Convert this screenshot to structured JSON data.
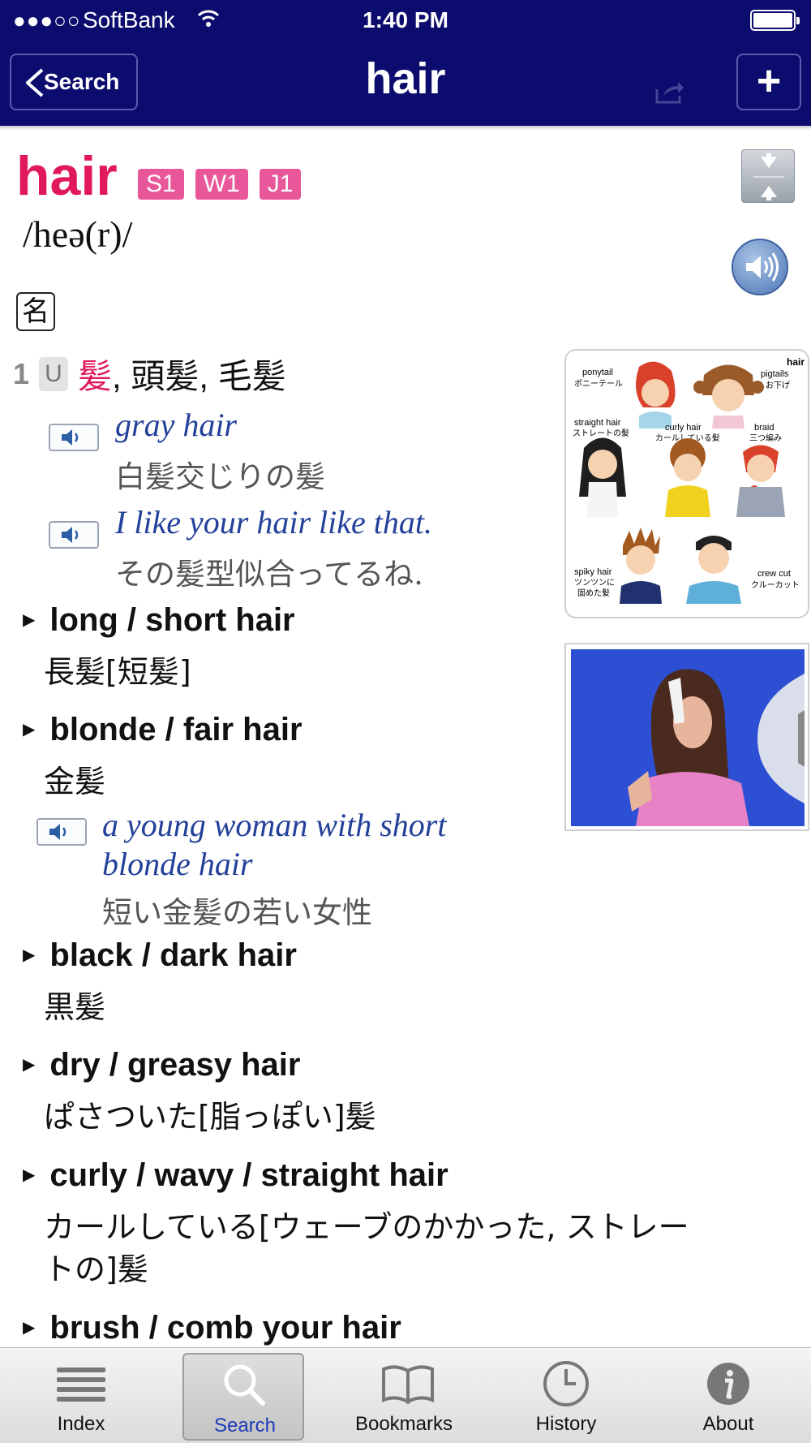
{
  "status": {
    "signal": "●●●○○",
    "carrier": "SoftBank",
    "time": "1:40 PM"
  },
  "nav": {
    "back_label": "Search",
    "title": "hair",
    "add_label": "+"
  },
  "entry": {
    "headword": "hair",
    "badges": [
      "S1",
      "W1",
      "J1"
    ],
    "pronunciation": "/heə(r)/",
    "part_of_speech": "名",
    "sense_number": "1",
    "countability": "U",
    "definition_highlight": "髪",
    "definition_rest": ", 頭髪, 毛髪"
  },
  "examples": [
    {
      "en": "gray hair",
      "ja": "白髪交じりの髪"
    },
    {
      "en": "I like your hair like that.",
      "ja": "その髪型似合ってるね."
    }
  ],
  "collocations": [
    {
      "phrase": "long / short hair",
      "ja": "長髪[短髪]"
    },
    {
      "phrase": "blonde / fair hair",
      "ja": "金髪"
    },
    {
      "phrase": "black / dark hair",
      "ja": "黒髪"
    },
    {
      "phrase": "dry / greasy hair",
      "ja": "ぱさついた[脂っぽい]髪"
    },
    {
      "phrase": "curly / wavy / straight hair",
      "ja": "カールしている[ウェーブのかかった, ストレー",
      "ja2": "トの]髪"
    },
    {
      "phrase": "brush / comb your hair",
      "ja": ""
    }
  ],
  "blonde_example": {
    "en1": "a young woman with short",
    "en2": "blonde hair",
    "ja": "短い金髪の若い女性"
  },
  "illustration": {
    "title": "hair",
    "labels": [
      {
        "en": "ponytail",
        "ja": "ポニーテール"
      },
      {
        "en": "pigtails",
        "ja": "お下げ"
      },
      {
        "en": "straight hair",
        "ja": "ストレートの髪"
      },
      {
        "en": "curly hair",
        "ja": "カールしている髪"
      },
      {
        "en": "braid",
        "ja": "三つ編み"
      },
      {
        "en": "spiky hair",
        "ja": "ツンツンに"
      },
      {
        "en": "",
        "ja": "固めた髪"
      },
      {
        "en": "crew cut",
        "ja": "クルーカット"
      }
    ]
  },
  "tabs": [
    {
      "label": "Index",
      "icon": "list-icon"
    },
    {
      "label": "Search",
      "icon": "magnifier-icon",
      "active": true
    },
    {
      "label": "Bookmarks",
      "icon": "book-icon"
    },
    {
      "label": "History",
      "icon": "clock-icon"
    },
    {
      "label": "About",
      "icon": "info-icon"
    }
  ],
  "colors": {
    "nav_bg": "#0c0c6e",
    "headword": "#e0195a",
    "badge": "#e8579a",
    "example_en": "#23409a",
    "tab_active": "#1c3ab8"
  }
}
